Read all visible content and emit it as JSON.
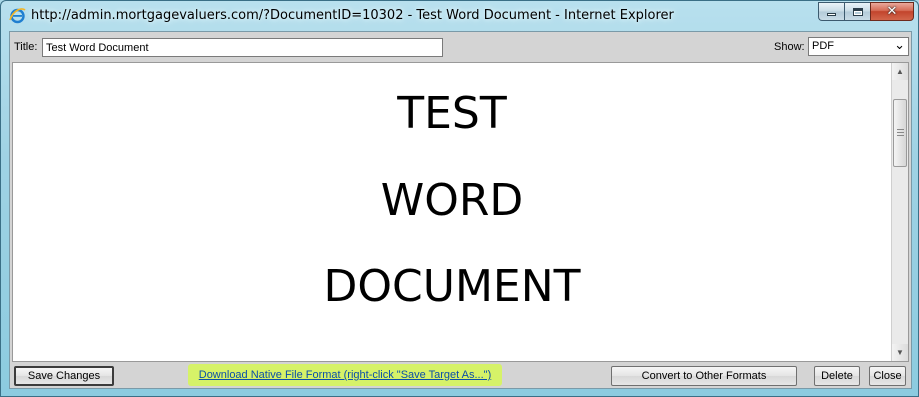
{
  "window": {
    "title": "http://admin.mortgagevaluers.com/?DocumentID=10302 - Test Word Document - Internet Explorer",
    "icon": "ie-icon",
    "controls": [
      "minimize-icon",
      "maximize-icon",
      "close-icon"
    ],
    "close_glyph": "✕"
  },
  "toolbar": {
    "title_label": "Title:",
    "title_value": "Test Word Document",
    "show_label": "Show:",
    "show_selected": "PDF"
  },
  "document": {
    "lines": [
      "TEST",
      "WORD",
      "DOCUMENT"
    ]
  },
  "footer": {
    "save_label": "Save Changes",
    "download_link": "Download Native File Format (right-click \"Save Target As...\")",
    "convert_label": "Convert to Other Formats",
    "delete_label": "Delete",
    "close_label": "Close",
    "highlight_color": "#d6f268"
  }
}
